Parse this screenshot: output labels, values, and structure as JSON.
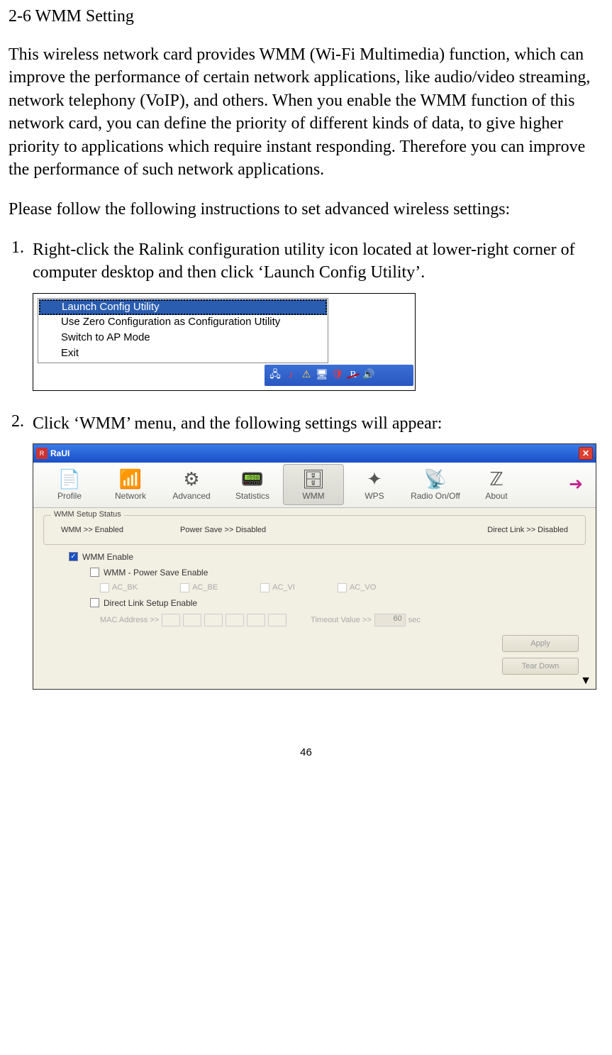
{
  "heading": "2-6 WMM Setting",
  "intro": "This wireless network card provides WMM (Wi-Fi Multimedia) function, which can improve the performance of certain network applications, like audio/video streaming, network telephony (VoIP), and others. When you enable the WMM function of this network card, you can define the priority of different kinds of data, to give higher priority to applications which require instant responding. Therefore you can improve the performance of such network applications.",
  "instructions_lead": "Please follow the following instructions to set advanced wireless settings:",
  "steps": {
    "s1_num": "1.",
    "s1_text": "Right-click the Ralink configuration utility icon located at lower-right corner of computer desktop and then click ‘Launch Config Utility’.",
    "s2_num": "2.",
    "s2_text": "Click ‘WMM’ menu, and the following settings will appear:"
  },
  "context_menu": {
    "items": {
      "launch": "Launch Config Utility",
      "zero": "Use Zero Configuration as Configuration Utility",
      "ap": "Switch to AP Mode",
      "exit": "Exit"
    }
  },
  "raui": {
    "title": "RaUI",
    "tabs": {
      "profile": "Profile",
      "network": "Network",
      "advanced": "Advanced",
      "statistics": "Statistics",
      "wmm": "WMM",
      "wps": "WPS",
      "radio": "Radio On/Off",
      "about": "About"
    },
    "status_legend": "WMM Setup Status",
    "status": {
      "wmm": "WMM >> Enabled",
      "ps": "Power Save >> Disabled",
      "dl": "Direct Link >> Disabled"
    },
    "checks": {
      "wmm_enable": "WMM Enable",
      "ps_enable": "WMM - Power Save Enable",
      "ac_bk": "AC_BK",
      "ac_be": "AC_BE",
      "ac_vi": "AC_VI",
      "ac_vo": "AC_VO",
      "dl_enable": "Direct Link Setup Enable",
      "mac_label": "MAC Address >>",
      "timeout_label": "Timeout Value >>",
      "timeout_value": "60",
      "timeout_unit": "sec"
    },
    "buttons": {
      "apply": "Apply",
      "tear": "Tear Down"
    }
  },
  "page_number": "46"
}
